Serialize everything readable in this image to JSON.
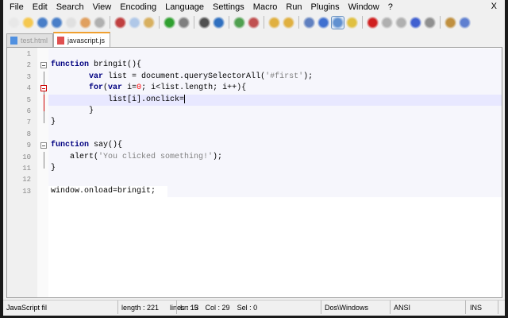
{
  "menu": [
    "File",
    "Edit",
    "Search",
    "View",
    "Encoding",
    "Language",
    "Settings",
    "Macro",
    "Run",
    "Plugins",
    "Window",
    "?"
  ],
  "close_label": "X",
  "toolbar": [
    "new-icon",
    "open-icon",
    "save-icon",
    "save-all-icon",
    "close-icon",
    "close-all-icon",
    "print-icon",
    "cut-icon",
    "copy-icon",
    "paste-icon",
    "undo-icon",
    "redo-icon",
    "find-icon",
    "replace-icon",
    "zoom-in-icon",
    "zoom-out-icon",
    "sync-v-icon",
    "sync-h-icon",
    "wrap-icon",
    "all-chars-icon",
    "indent-guide-icon",
    "udl-icon",
    "record-icon",
    "stop-icon",
    "play-icon",
    "run-multiple-icon",
    "save-macro-icon",
    "screenshot-icon",
    "spellcheck-icon"
  ],
  "tabs": [
    {
      "label": "test.html",
      "active": false
    },
    {
      "label": "javascript.js",
      "active": true
    }
  ],
  "lines": [
    {
      "n": "1",
      "html": ""
    },
    {
      "n": "2",
      "html": "<span class='kw'>function</span> bringit(){"
    },
    {
      "n": "3",
      "html": "        <span class='kw'>var</span> list = document.querySelectorAll(<span class='str'>'#first'</span>);"
    },
    {
      "n": "4",
      "html": "        <span class='kw'>for</span>(<span class='kw'>var</span> i=<span class='num'>0</span>; i&lt;list.length; i++){"
    },
    {
      "n": "5",
      "html": "            list[i].onclick=<span class='caret'></span>"
    },
    {
      "n": "6",
      "html": "        }"
    },
    {
      "n": "7",
      "html": "}"
    },
    {
      "n": "8",
      "html": ""
    },
    {
      "n": "9",
      "html": "<span class='kw'>function</span> say(){"
    },
    {
      "n": "10",
      "html": "    alert(<span class='str'>'You clicked something!'</span>);"
    },
    {
      "n": "11",
      "html": "}"
    },
    {
      "n": "12",
      "html": ""
    },
    {
      "n": "13",
      "html": "window.onload=bringit;"
    }
  ],
  "status": {
    "type": "JavaScript fil",
    "length": "length : 221",
    "lines": "lines : 13",
    "ln": "Ln : 5",
    "col": "Col : 29",
    "sel": "Sel : 0",
    "eol": "Dos\\Windows",
    "enc": "ANSI",
    "mode": "INS"
  }
}
